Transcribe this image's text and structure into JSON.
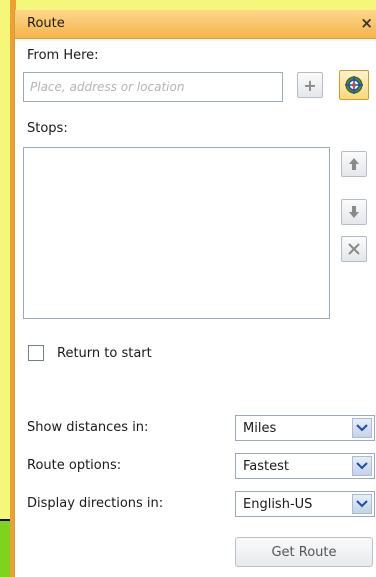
{
  "panel": {
    "title": "Route",
    "close_glyph": "×"
  },
  "from": {
    "label": "From Here:",
    "placeholder": "Place, address or location",
    "value": ""
  },
  "buttons": {
    "add_icon": "plus-icon",
    "locate_icon": "locate-icon",
    "move_up_icon": "arrow-up-icon",
    "move_down_icon": "arrow-down-icon",
    "remove_icon": "remove-icon"
  },
  "stops": {
    "label": "Stops:",
    "items": []
  },
  "return_to_start": {
    "label": "Return to start",
    "checked": false
  },
  "options": [
    {
      "label": "Show distances in:",
      "value": "Miles"
    },
    {
      "label": "Route options:",
      "value": "Fastest"
    },
    {
      "label": "Display directions in:",
      "value": "English-US"
    }
  ],
  "get_route_label": "Get Route",
  "colors": {
    "accent": "#f5b34a",
    "background": "#f4f77a",
    "green": "#7ed321"
  }
}
